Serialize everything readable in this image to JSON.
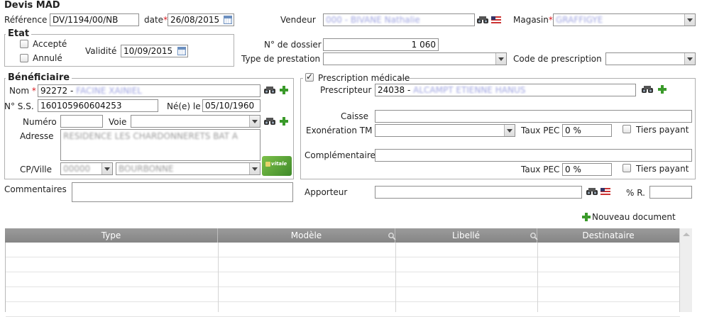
{
  "title": "Devis MAD",
  "reference": {
    "label": "Référence",
    "value": "DV/1194/00/NB"
  },
  "date": {
    "label": "date",
    "required": "*",
    "value": "26/08/2015"
  },
  "vendeur": {
    "label": "Vendeur",
    "value": "000 - BIVANE Nathalie"
  },
  "magasin": {
    "label": "Magasin",
    "required": "*",
    "value": "GRAFFIGYE"
  },
  "etat": {
    "legend": "Etat",
    "accepte_label": "Accepté",
    "annule_label": "Annulé",
    "validite_label": "Validité",
    "validite_value": "10/09/2015"
  },
  "dossier": {
    "label": "N° de dossier",
    "value": "1 060"
  },
  "type_prestation": {
    "label": "Type de prestation",
    "value": ""
  },
  "code_prescription": {
    "label": "Code de prescription",
    "value": ""
  },
  "beneficiaire": {
    "legend": "Bénéficiaire",
    "nom_label": "Nom",
    "nom_required": "*",
    "nom_value": "92272 - ",
    "nom_hidden": "FACINE XAINIEL",
    "ss_label": "N° S.S.",
    "ss_value": "160105960604253",
    "ne_label": "Né(e) le",
    "ne_value": "05/10/1960",
    "numero_label": "Numéro",
    "voie_label": "Voie",
    "adresse_label": "Adresse",
    "adresse_hidden": "RESIDENCE LES CHARDONNERETS BAT A",
    "cpville_label": "CP/Ville",
    "cp_hidden": "00000",
    "ville_hidden": "BOURBONNE",
    "vitale_text": "vitale"
  },
  "prescription": {
    "legend": "Prescription médicale",
    "checked": true,
    "prescripteur_label": "Prescripteur",
    "prescripteur_value": "24038 - ",
    "prescripteur_hidden": "ALCAMPT ETIENNE HANUS",
    "caisse_label": "Caisse",
    "exoneration_label": "Exonération TM",
    "taux_pec_label": "Taux PEC",
    "taux_pec_value": "0 %",
    "tiers_payant_label": "Tiers payant",
    "complementaire_label": "Complémentaire",
    "taux_pec2_label": "Taux PEC",
    "taux_pec2_value": "0 %",
    "tiers_payant2_label": "Tiers payant"
  },
  "commentaires": {
    "label": "Commentaires",
    "value": ""
  },
  "apporteur": {
    "label": "Apporteur",
    "value": ""
  },
  "pourcent_r": {
    "label": "% R.",
    "value": ""
  },
  "nouveau_document": "Nouveau document",
  "grid": {
    "columns": [
      "Type",
      "Modèle",
      "Libellé",
      "Destinataire"
    ],
    "rows": 5
  },
  "colors": {
    "accent_green": "#3a9a2a",
    "required_red": "#d9181f",
    "header_gray": "#8e8e8e"
  }
}
